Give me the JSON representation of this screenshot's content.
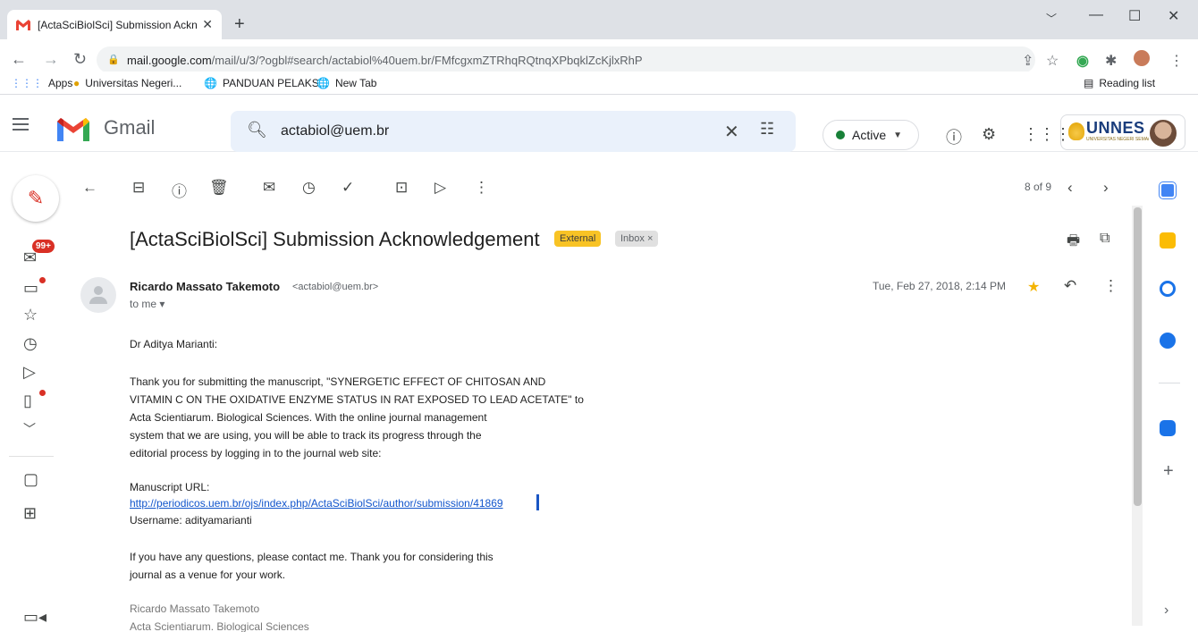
{
  "browser": {
    "tab_title": "[ActaSciBiolSci] Submission Ackn",
    "tab_close": "✕",
    "new_tab": "+",
    "url_host": "mail.google.com",
    "url_path": "/mail/u/3/?ogbl#search/actabiol%40uem.br/FMfcgxmZTRhqRQtnqXPbqklZcKjlxRhP",
    "bookmarks": [
      {
        "label": "Apps"
      },
      {
        "label": "Universitas Negeri..."
      },
      {
        "label": "PANDUAN PELAKS..."
      },
      {
        "label": "New Tab"
      }
    ],
    "reading_list": "Reading list"
  },
  "gmail": {
    "brand": "Gmail",
    "search_value": "actabiol@uem.br",
    "status": "Active",
    "org_logo": "UNNES",
    "org_logo_sub": "UNIVERSITAS NEGERI SEMARANG",
    "compose_badge": "99+"
  },
  "toolbar": {
    "pager": "8 of 9"
  },
  "message": {
    "subject": "[ActaSciBiolSci] Submission Acknowledgement",
    "label_external": "External",
    "label_inbox": "Inbox ×",
    "sender_name": "Ricardo Massato Takemoto",
    "sender_email": "<actabiol@uem.br>",
    "to": "to me ▾",
    "date": "Tue, Feb 27, 2018, 2:14 PM",
    "greeting": "Dr Aditya Marianti:",
    "para1": [
      "Thank you for submitting the manuscript, \"SYNERGETIC EFFECT OF CHITOSAN AND",
      "VITAMIN C ON THE OXIDATIVE ENZYME STATUS IN RAT EXPOSED TO LEAD ACETATE\" to",
      "Acta Scientiarum. Biological Sciences. With the online journal management",
      "system that we are using, you will be able to track its progress through the",
      "editorial process by logging in to the journal web site:"
    ],
    "url_label": "Manuscript URL:",
    "url": "http://periodicos.uem.br/ojs/index.php/ActaSciBiolSci/author/submission/41869",
    "username": "Username: adityamarianti",
    "para2": [
      "If you have any questions, please contact me. Thank you for considering this",
      "journal as a venue for your work."
    ],
    "signature": [
      "Ricardo Massato Takemoto",
      "Acta Scientiarum. Biological Sciences"
    ]
  }
}
